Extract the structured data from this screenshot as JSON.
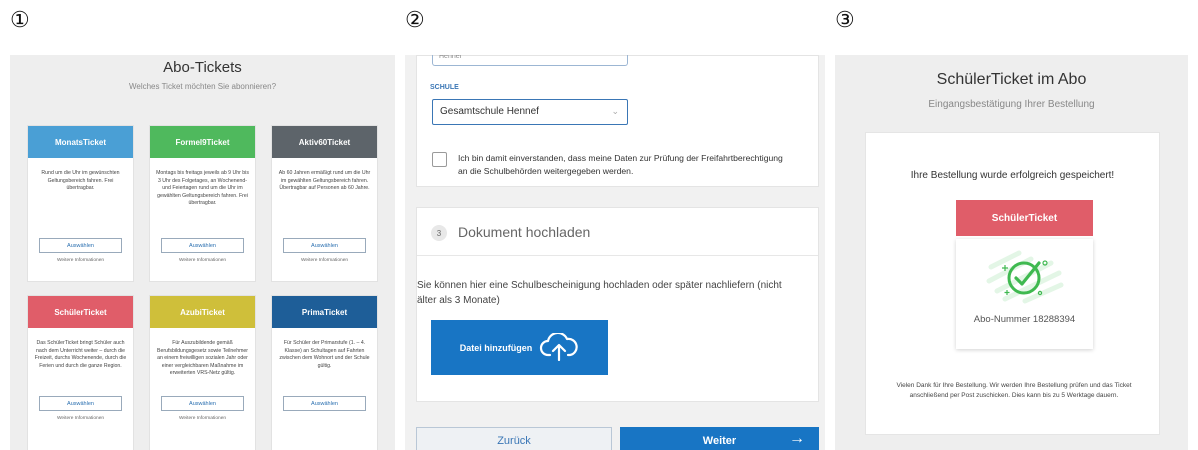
{
  "steps": [
    "①",
    "②",
    "③"
  ],
  "panel1": {
    "title": "Abo-Tickets",
    "subtitle": "Welches Ticket möchten Sie abonnieren?",
    "tickets": [
      {
        "name": "MonatsTicket",
        "color": "#4a9fd5",
        "description": "Rund um die Uhr im gewünschten Geltungsbereich fahren. Frei übertragbar.",
        "select_label": "Auswählen",
        "more_label": "Weitere Informationen"
      },
      {
        "name": "Formel9Ticket",
        "color": "#4fb95d",
        "description": "Montags bis freitags jeweils ab 9 Uhr bis 3 Uhr des Folgetages, an Wochenend- und Feiertagen rund um die Uhr im gewählten Geltungsbereich fahren. Frei übertragbar.",
        "select_label": "Auswählen",
        "more_label": "Weitere Informationen"
      },
      {
        "name": "Aktiv60Ticket",
        "color": "#5d646a",
        "description": "Ab 60 Jahren ermäßigt rund um die Uhr im gewählten Geltungsbereich fahren. Übertragbar auf Personen ab 60 Jahre.",
        "select_label": "Auswählen",
        "more_label": "Weitere Informationen"
      },
      {
        "name": "SchülerTicket",
        "color": "#e05d69",
        "description": "Das SchülerTicket bringt Schüler auch nach dem Unterricht weiter – durch die Freizeit, durchs Wochenende, durch die Ferien und durch die ganze Region.",
        "select_label": "Auswählen",
        "more_label": "Weitere Informationen"
      },
      {
        "name": "AzubiTicket",
        "color": "#cfbf3a",
        "description": "Für Auszubildende gemäß Berufsbildungsgesetz sowie Teilnehmer an einem freiwilligen sozialen Jahr oder einer vergleichbaren Maßnahme im erweiterten VRS-Netz gültig.",
        "select_label": "Auswählen",
        "more_label": "Weitere Informationen"
      },
      {
        "name": "PrimaTicket",
        "color": "#1e5e98",
        "description": "Für Schüler der Primarstufe (1. – 4. Klasse) an Schultagen auf Fahrten zwischen dem Wohnort und der Schule gültig.",
        "select_label": "Auswählen",
        "more_label": ""
      }
    ]
  },
  "panel2": {
    "prev_field_value": "Hennef",
    "school_label": "SCHULE",
    "school_value": "Gesamtschule Hennef",
    "consent_text": "Ich bin damit einverstanden, dass meine Daten zur Prüfung der Freifahrtberechtigung an die Schulbehörden weitergegeben werden.",
    "section_number": "3",
    "section_title": "Dokument hochladen",
    "upload_text": "Sie können hier eine Schulbescheinigung hochladen oder später nachliefern (nicht älter als 3 Monate)",
    "upload_button": "Datei hinzufügen",
    "back_button": "Zurück",
    "next_button": "Weiter",
    "accent": "#1875c4"
  },
  "panel3": {
    "title": "SchülerTicket im Abo",
    "subtitle": "Eingangsbestätigung Ihrer Bestellung",
    "success_text": "Ihre Bestellung wurde erfolgreich gespeichert!",
    "ticket_name": "SchülerTicket",
    "ticket_color": "#e05d69",
    "order_number": "Abo-Nummer 18288394",
    "thanks_text": "Vielen Dank für Ihre Bestellung. Wir werden Ihre Bestellung prüfen und das Ticket anschließend per Post zuschicken. Dies kann bis zu 5 Werktage dauern.",
    "check_color": "#3fb950"
  }
}
